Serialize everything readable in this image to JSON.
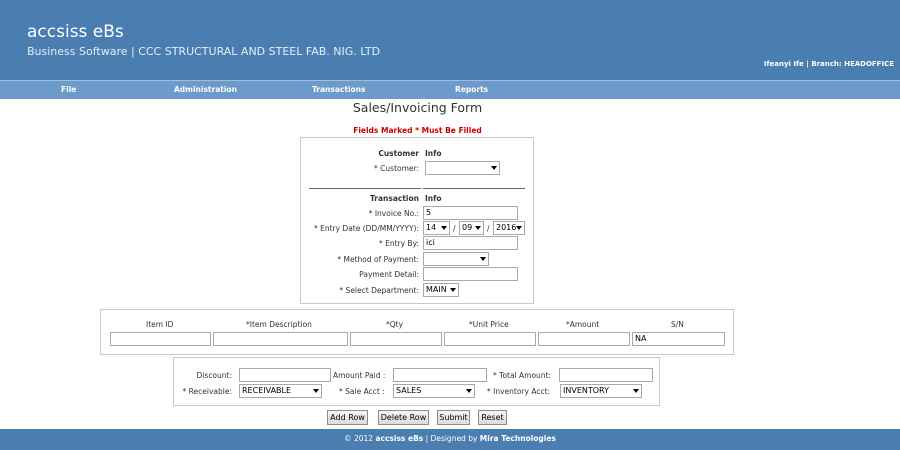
{
  "header": {
    "app_title": "accsiss eBs",
    "subtitle": "Business Software | CCC STRUCTURAL AND STEEL FAB. NIG. LTD",
    "user_info": "Ifeanyi Ife | Branch: HEADOFFICE"
  },
  "nav": [
    "File",
    "Administration",
    "Transactions",
    "Reports"
  ],
  "form": {
    "title": "Sales/Invoicing Form",
    "required_note": "Fields Marked * Must Be Filled"
  },
  "customer_section": {
    "heading_left": "Customer",
    "heading_right": "Info",
    "customer_label": "* Customer:",
    "customer_value": ""
  },
  "transaction_section": {
    "heading_left": "Transaction",
    "heading_right": "Info",
    "invoice_label": "* Invoice No.:",
    "invoice_value": "5",
    "entry_date_label": "* Entry Date (DD/MM/YYYY):",
    "day": "14",
    "month": "09",
    "year": "2016",
    "date_sep": "/",
    "entry_by_label": "* Entry By:",
    "entry_by_value": "ici",
    "payment_method_label": "* Method of Payment:",
    "payment_method_value": "",
    "payment_detail_label": "Payment Detail:",
    "payment_detail_value": "",
    "department_label": "* Select Department:",
    "department_value": "MAIN"
  },
  "items_table": {
    "headers": [
      "Item ID",
      "*Item Description",
      "*Qty",
      "*Unit Price",
      "*Amount",
      "S/N"
    ],
    "row": [
      "",
      "",
      "",
      "",
      "",
      "NA"
    ]
  },
  "totals": {
    "discount_label": "Discount:",
    "discount_value": "",
    "amount_paid_label": "Amount Paid :",
    "amount_paid_value": "",
    "total_amount_label": "* Total Amount:",
    "total_amount_value": "",
    "receivable_label": "* Receivable:",
    "receivable_value": "RECEIVABLE",
    "sale_acct_label": "* Sale Acct :",
    "sale_acct_value": "SALES",
    "inventory_acct_label": "* Inventory Acct:",
    "inventory_acct_value": "INVENTORY"
  },
  "buttons": {
    "add_row": "Add Row",
    "delete_row": "Delete Row",
    "submit": "Submit",
    "reset": "Reset"
  },
  "footer": {
    "copyright": "© 2012",
    "product": "accsiss eBs",
    "designed_by": "| Designed by",
    "company": "Mira Technologies"
  },
  "colors": {
    "header_bg": "#4a7eb0",
    "nav_bg": "#6c9acb",
    "required_red": "#cc0000"
  }
}
